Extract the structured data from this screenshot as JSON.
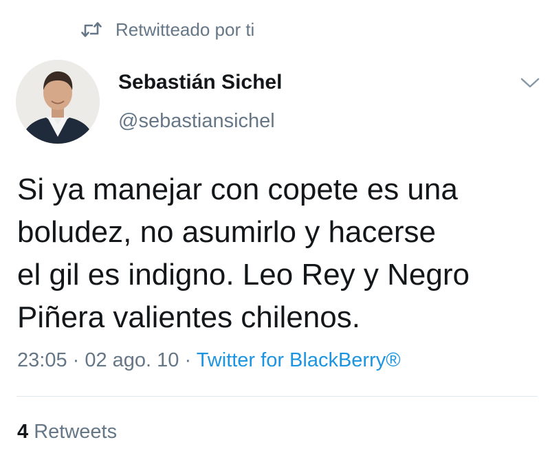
{
  "retweet_context": {
    "icon": "retweet-icon",
    "label": "Retwitteado por ti"
  },
  "author": {
    "avatar": "profile-photo",
    "name": "Sebastián Sichel",
    "handle": "@sebastiansichel"
  },
  "menu": {
    "icon": "chevron-down-icon"
  },
  "tweet": {
    "text_lines": [
      "Si ya manejar con copete es una",
      "boludez, no asumirlo y hacerse",
      "el gil es indigno. Leo Rey y Negro",
      "Piñera valientes chilenos."
    ],
    "time": "23:05",
    "separator": " · ",
    "date": "02 ago. 10",
    "source": "Twitter for BlackBerry®"
  },
  "stats": {
    "retweets_count": "4",
    "retweets_label": "Retweets"
  },
  "colors": {
    "text": "#14171a",
    "muted": "#657786",
    "link": "#1b95e0",
    "divider": "#e1e8ed"
  }
}
